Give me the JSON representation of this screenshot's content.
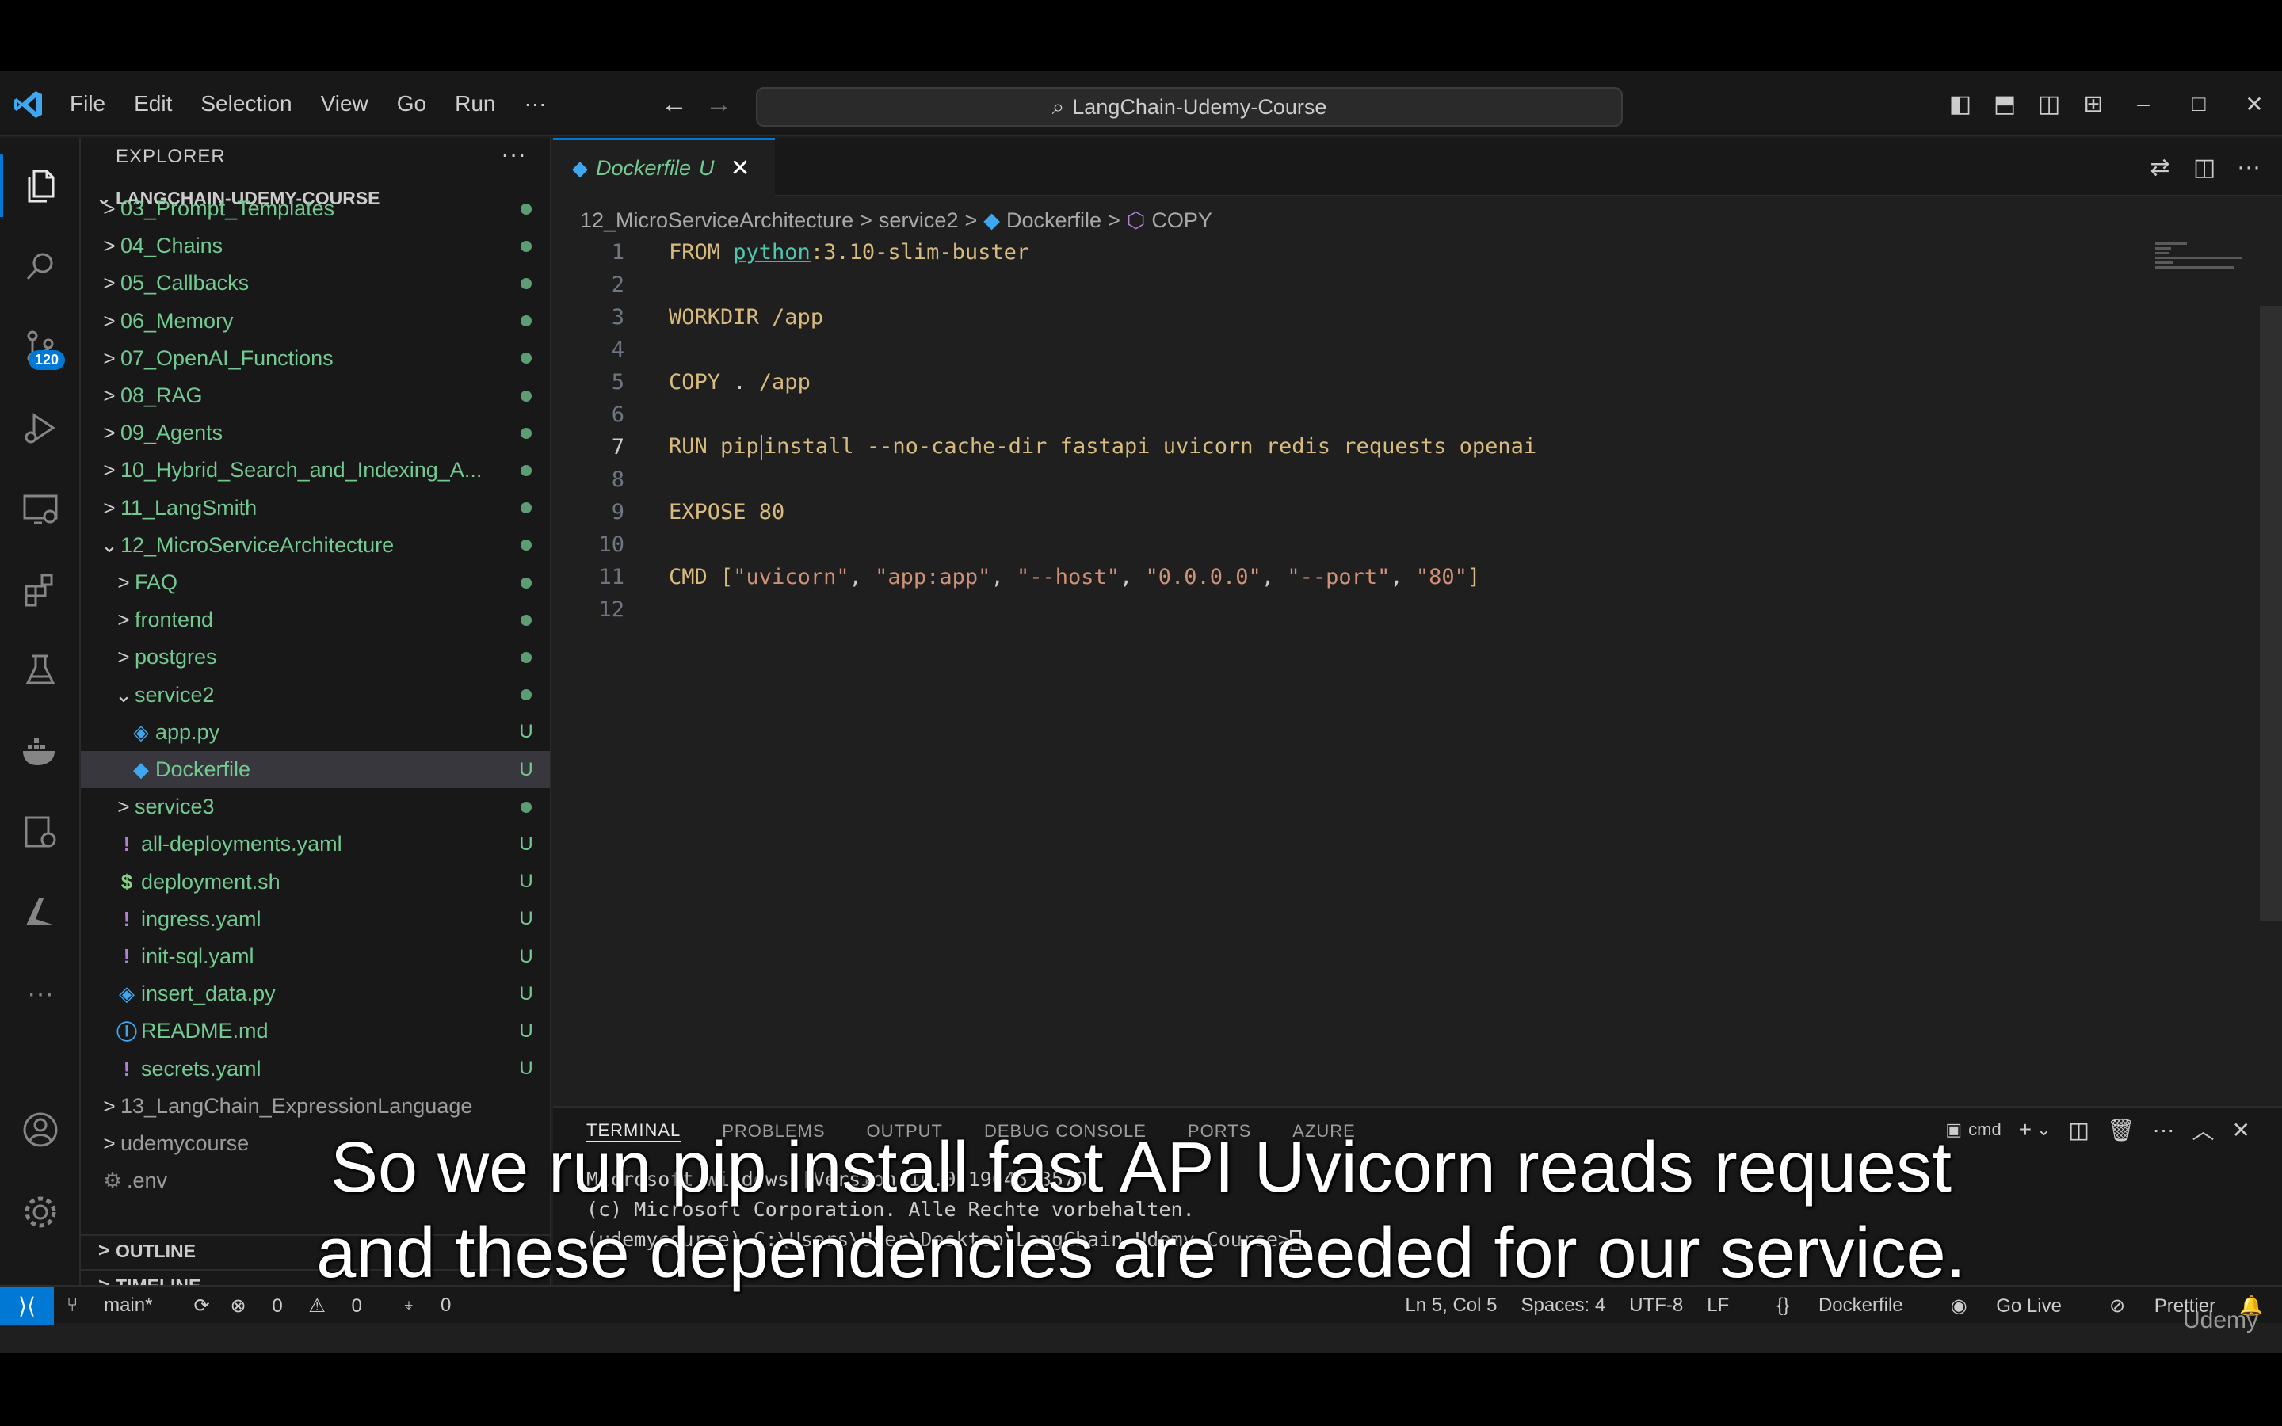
{
  "titlebar": {
    "menu": [
      "File",
      "Edit",
      "Selection",
      "View",
      "Go",
      "Run",
      "···"
    ],
    "search": "LangChain-Udemy-Course"
  },
  "activity": {
    "scm_badge": "120"
  },
  "explorer": {
    "title": "EXPLORER",
    "more": "···",
    "root": "LANGCHAIN-UDEMY-COURSE",
    "items": [
      {
        "name": "03_Prompt_Templates",
        "status": "●",
        "chev": ">",
        "icon": "",
        "indent": 0
      },
      {
        "name": "04_Chains",
        "status": "●",
        "chev": ">",
        "icon": "",
        "indent": 0
      },
      {
        "name": "05_Callbacks",
        "status": "●",
        "chev": ">",
        "icon": "",
        "indent": 0
      },
      {
        "name": "06_Memory",
        "status": "●",
        "chev": ">",
        "icon": "",
        "indent": 0
      },
      {
        "name": "07_OpenAI_Functions",
        "status": "●",
        "chev": ">",
        "icon": "",
        "indent": 0
      },
      {
        "name": "08_RAG",
        "status": "●",
        "chev": ">",
        "icon": "",
        "indent": 0
      },
      {
        "name": "09_Agents",
        "status": "●",
        "chev": ">",
        "icon": "",
        "indent": 0
      },
      {
        "name": "10_Hybrid_Search_and_Indexing_A...",
        "status": "●",
        "chev": ">",
        "icon": "",
        "indent": 0
      },
      {
        "name": "11_LangSmith",
        "status": "●",
        "chev": ">",
        "icon": "",
        "indent": 0
      },
      {
        "name": "12_MicroServiceArchitecture",
        "status": "●",
        "chev": "⌄",
        "icon": "",
        "indent": 0
      },
      {
        "name": "FAQ",
        "status": "●",
        "chev": ">",
        "icon": "",
        "indent": 1
      },
      {
        "name": "frontend",
        "status": "●",
        "chev": ">",
        "icon": "",
        "indent": 1
      },
      {
        "name": "postgres",
        "status": "●",
        "chev": ">",
        "icon": "",
        "indent": 1
      },
      {
        "name": "service2",
        "status": "●",
        "chev": "⌄",
        "icon": "",
        "indent": 1
      },
      {
        "name": "app.py",
        "status": "U",
        "chev": "",
        "icon": "python",
        "indent": 2
      },
      {
        "name": "Dockerfile",
        "status": "U",
        "chev": "",
        "icon": "docker",
        "indent": 2
      },
      {
        "name": "service3",
        "status": "●",
        "chev": ">",
        "icon": "",
        "indent": 1
      },
      {
        "name": "all-deployments.yaml",
        "status": "U",
        "chev": "",
        "icon": "yaml",
        "indent": 1
      },
      {
        "name": "deployment.sh",
        "status": "U",
        "chev": "",
        "icon": "shell",
        "indent": 1
      },
      {
        "name": "ingress.yaml",
        "status": "U",
        "chev": "",
        "icon": "yaml",
        "indent": 1
      },
      {
        "name": "init-sql.yaml",
        "status": "U",
        "chev": "",
        "icon": "yaml",
        "indent": 1
      },
      {
        "name": "insert_data.py",
        "status": "U",
        "chev": "",
        "icon": "python",
        "indent": 1
      },
      {
        "name": "README.md",
        "status": "U",
        "chev": "",
        "icon": "info",
        "indent": 1
      },
      {
        "name": "secrets.yaml",
        "status": "U",
        "chev": "",
        "icon": "yaml",
        "indent": 1
      },
      {
        "name": "13_LangChain_ExpressionLanguage",
        "status": "",
        "chev": ">",
        "icon": "",
        "indent": 0
      },
      {
        "name": "udemycourse",
        "status": "",
        "chev": ">",
        "icon": "",
        "indent": 0
      },
      {
        "name": ".env",
        "status": "",
        "chev": "",
        "icon": "gear",
        "indent": 0
      }
    ],
    "outline": "OUTLINE",
    "timeline": "TIMELINE"
  },
  "tab": {
    "name": "Dockerfile",
    "status": "U",
    "close": "✕"
  },
  "breadcrumb": [
    "12_MicroServiceArchitecture",
    "service2",
    "Dockerfile",
    "COPY"
  ],
  "code": {
    "current_line": 7,
    "lines": [
      [
        {
          "t": "kw",
          "v": "FROM "
        },
        {
          "t": "lk",
          "v": "python"
        },
        {
          "t": "kw",
          "v": ":3.10-slim-buster"
        }
      ],
      [],
      [
        {
          "t": "kw",
          "v": "WORKDIR "
        },
        {
          "t": "kw",
          "v": "/app"
        }
      ],
      [],
      [
        {
          "t": "kw",
          "v": "COPY "
        },
        {
          "t": "txt",
          "v": ". "
        },
        {
          "t": "kw",
          "v": "/app"
        }
      ],
      [],
      [
        {
          "t": "kw",
          "v": "RUN "
        },
        {
          "t": "kw",
          "v": "pip"
        },
        {
          "t": "cur",
          "v": ""
        },
        {
          "t": "kw",
          "v": "install --no-cache-dir fastapi uvicorn redis requests openai"
        }
      ],
      [],
      [
        {
          "t": "kw",
          "v": "EXPOSE "
        },
        {
          "t": "num",
          "v": "80"
        }
      ],
      [],
      [
        {
          "t": "kw",
          "v": "CMD "
        },
        {
          "t": "kw",
          "v": "["
        },
        {
          "t": "str",
          "v": "\"uvicorn\""
        },
        {
          "t": "txt",
          "v": ", "
        },
        {
          "t": "str",
          "v": "\"app:app\""
        },
        {
          "t": "txt",
          "v": ", "
        },
        {
          "t": "str",
          "v": "\"--host\""
        },
        {
          "t": "txt",
          "v": ", "
        },
        {
          "t": "str",
          "v": "\"0.0.0.0\""
        },
        {
          "t": "txt",
          "v": ", "
        },
        {
          "t": "str",
          "v": "\"--port\""
        },
        {
          "t": "txt",
          "v": ", "
        },
        {
          "t": "str",
          "v": "\"80\""
        },
        {
          "t": "kw",
          "v": "]"
        }
      ],
      []
    ]
  },
  "panel": {
    "tabs": [
      "TERMINAL",
      "PROBLEMS",
      "OUTPUT",
      "DEBUG CONSOLE",
      "PORTS",
      "AZURE"
    ],
    "shell": "cmd",
    "lines": [
      "Microsoft Windows [Version 10.0.19045.3570]",
      "(c) Microsoft Corporation. Alle Rechte vorbehalten.",
      "(udemycourse) C:\\Users\\User\\Desktop\\LangChain-Udemy-Course>"
    ]
  },
  "status": {
    "branch": "main*",
    "errors": "0",
    "warnings": "0",
    "ports": "0",
    "position": "Ln 5, Col 5",
    "spaces": "Spaces: 4",
    "encoding": "UTF-8",
    "eol": "LF",
    "language": "Dockerfile",
    "golive": "Go Live",
    "prettier": "Prettier"
  },
  "caption": {
    "line1": "So we run pip install fast API Uvicorn reads request",
    "line2": "and these dependencies are needed for our service."
  },
  "watermark": "Udemy",
  "colors": {
    "accent": "#0078d4",
    "untracked": "#73c991",
    "keyword": "#d7ba7d",
    "string": "#ce9178"
  }
}
